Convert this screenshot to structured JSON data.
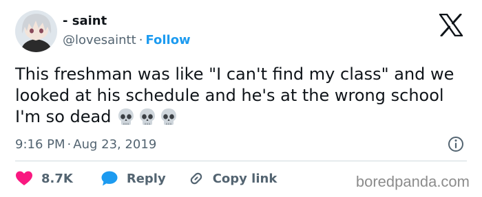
{
  "author": {
    "display_name": "- saint",
    "handle": "@lovesaintt",
    "separator": "·",
    "follow_label": "Follow"
  },
  "tweet": {
    "text": "This freshman was like \"I can't find my class\" and we looked at his schedule and he's at the wrong school I'm so dead",
    "emoji": [
      "skull",
      "skull",
      "skull"
    ]
  },
  "meta": {
    "time": "9:16 PM",
    "separator": "·",
    "date": "Aug 23, 2019"
  },
  "actions": {
    "likes": "8.7K",
    "reply_label": "Reply",
    "copy_link_label": "Copy link"
  },
  "watermark": "boredpanda.com",
  "colors": {
    "accent": "#1d9bf0",
    "like": "#f91880",
    "text": "#0f1419",
    "muted": "#536471"
  },
  "icons": [
    "x-logo-icon",
    "info-icon",
    "heart-icon",
    "reply-bubble-icon",
    "link-icon",
    "skull-emoji"
  ]
}
